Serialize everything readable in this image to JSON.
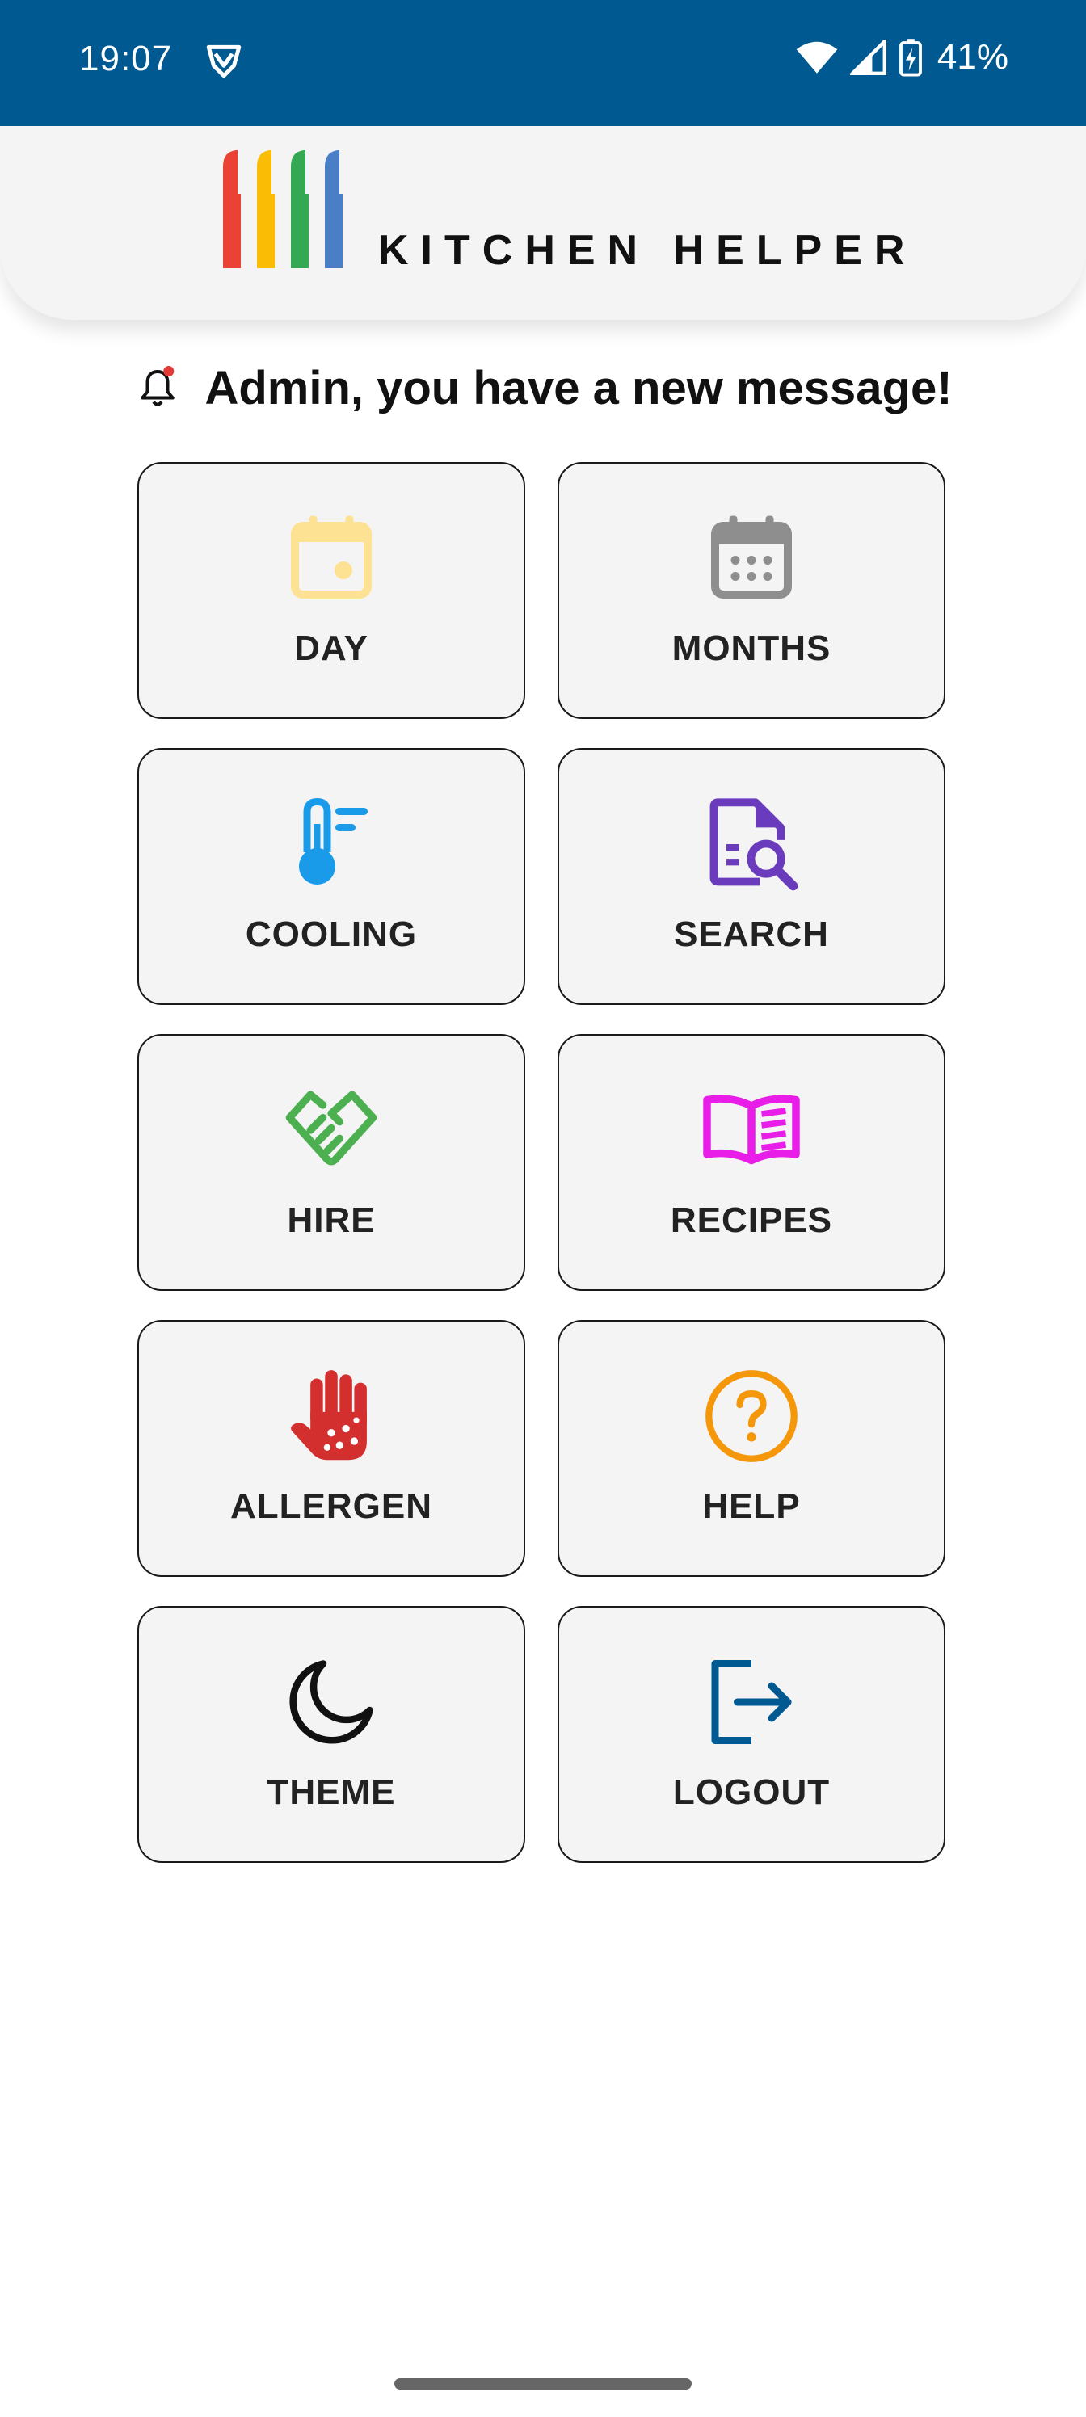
{
  "status_bar": {
    "time": "19:07",
    "battery": "41%",
    "icons": [
      "vpn-shield-icon",
      "wifi-icon",
      "cell-signal-icon",
      "battery-charging-icon"
    ]
  },
  "header": {
    "title": "KITCHEN HELPER",
    "logo_colors": [
      "#ea4335",
      "#fbbc05",
      "#34a853",
      "#4a7fc8"
    ]
  },
  "notification": {
    "text": "Admin, you have a new message!",
    "icon": "bell-icon",
    "dot_color": "#e53935"
  },
  "menu": {
    "items": [
      {
        "label": "DAY",
        "icon": "calendar-day-icon",
        "color": "#fde293"
      },
      {
        "label": "MONTHS",
        "icon": "calendar-month-icon",
        "color": "#8e8e8e"
      },
      {
        "label": "COOLING",
        "icon": "thermometer-icon",
        "color": "#1a9bea"
      },
      {
        "label": "SEARCH",
        "icon": "document-search-icon",
        "color": "#6b3bbd"
      },
      {
        "label": "HIRE",
        "icon": "handshake-icon",
        "color": "#4caf50"
      },
      {
        "label": "RECIPES",
        "icon": "open-book-icon",
        "color": "#e81ee8"
      },
      {
        "label": "ALLERGEN",
        "icon": "allergen-hand-icon",
        "color": "#d32f2f"
      },
      {
        "label": "HELP",
        "icon": "help-circle-icon",
        "color": "#f5970a"
      },
      {
        "label": "THEME",
        "icon": "moon-icon",
        "color": "#111111"
      },
      {
        "label": "LOGOUT",
        "icon": "logout-icon",
        "color": "#005a91"
      }
    ]
  }
}
